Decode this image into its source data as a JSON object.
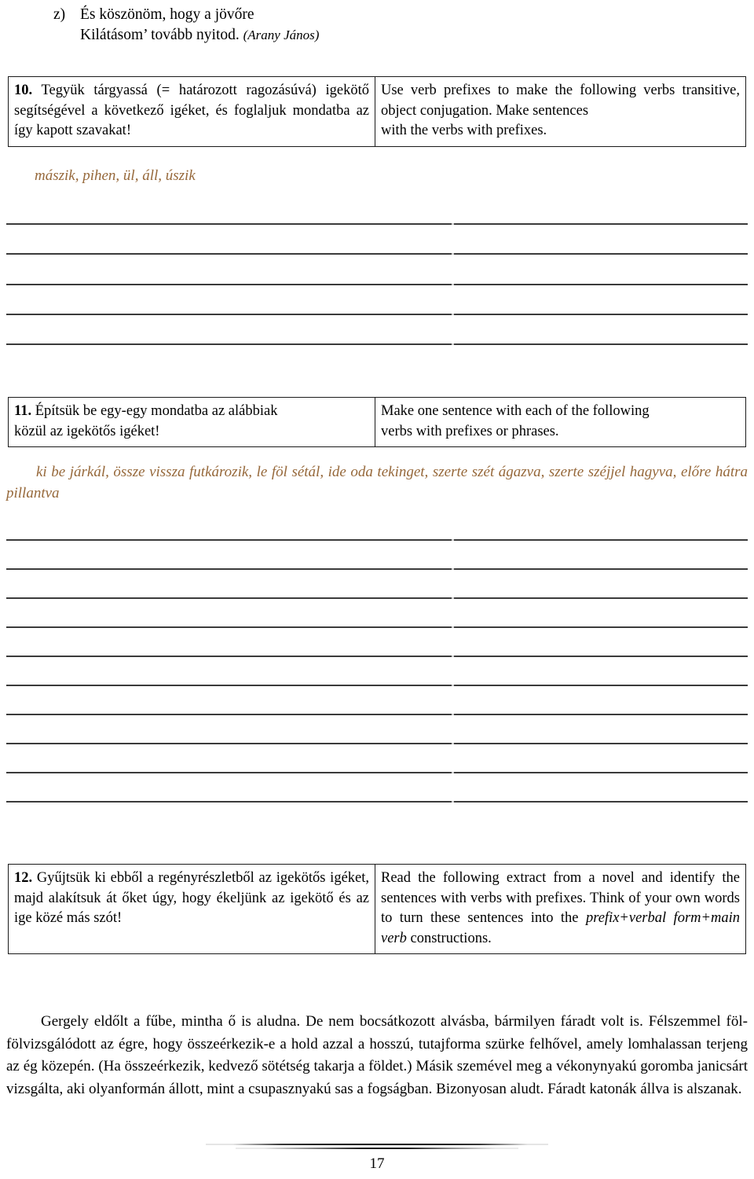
{
  "poem": {
    "marker": "z)",
    "line1": "És köszönöm, hogy a jövőre",
    "line2": "Kilátásom’ tovább nyitod.",
    "attribution": "(Arany János)"
  },
  "exercises": [
    {
      "number": "10.",
      "hungarian": "Tegyük tárgyassá (= határozott ragozásúvá) igekötő segítségével a következő igéket, és foglaljuk mondatba az így kapott szavakat!",
      "english_1": "Use verb prefixes to make the following verbs transitive, object conjugation. Make sentences",
      "english_2": "with the verbs with prefixes.",
      "wordlist": "mászik, pihen, ül, áll, úszik",
      "answer_lines": 5
    },
    {
      "number": "11.",
      "hungarian_1": "Építsük be egy-egy mondatba az alábbiak",
      "hungarian_2": "közül az igekötős igéket!",
      "english_1": "Make one sentence with each of the following",
      "english_2": "verbs with prefixes or phrases.",
      "wordlist": "ki be járkál, össze vissza futkározik, le föl sétál, ide oda tekinget, szerte szét ágazva, szerte széjjel hagyva, előre hátra pillantva",
      "answer_lines": 10
    },
    {
      "number": "12.",
      "hungarian": "Gyűjtsük ki ebből a regényrészletből az igekötős igéket, majd alakítsuk át őket úgy, hogy ékeljünk az igekötő és az ige közé más szót!",
      "english_a": "Read the following extract from a novel and identify the sentences with verbs with prefixes. Think of your own words to turn these sentences into the ",
      "english_italic": "prefix+verbal form+main verb",
      "english_b": " constructions."
    }
  ],
  "extract": {
    "paragraph_1": "Gergely eldőlt a fűbe, mintha ő is aludna. De nem bocsátkozott alvásba, bármilyen fáradt volt is. Félszemmel föl-fölvizsgálódott az égre, hogy összeérkezik-e a hold azzal a hosszú, tutajforma szürke felhővel, amely lomhalassan terjeng az ég közepén. (Ha összeérkezik, kedvező sötétség takarja a földet.) Másik szemével meg a vékonynyakú goromba janicsárt vizsgálta, aki olyanformán állott, mint a csupasznyakú sas a fogságban. Bizonyosan aludt. Fáradt katonák állva is alszanak."
  },
  "footer": {
    "page_number": "17"
  },
  "colors": {
    "wordlist_brown": "#96683a",
    "rule_gray": "#3b3b3b",
    "table_border": "#1a1a1a"
  }
}
